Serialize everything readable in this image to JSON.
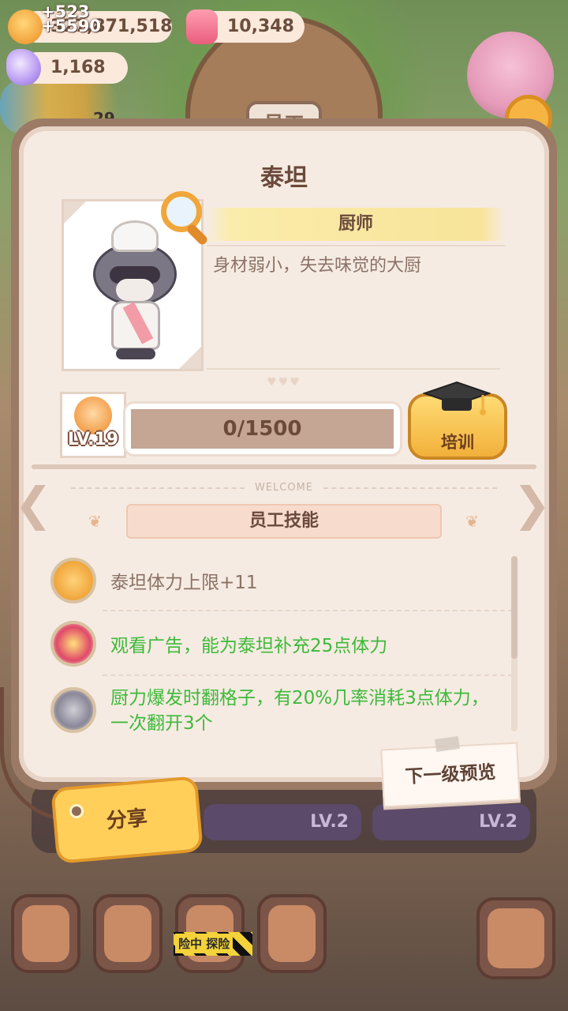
{
  "resources": {
    "gain_a": "+523",
    "gain_b": "+5590",
    "coins": "377,871,518",
    "gems": "10,348",
    "crystals": "1,168"
  },
  "background": {
    "title_tab": "员工",
    "lv_a": "LV.2",
    "lv_b": "LV.2",
    "adventure_badge": "险中 探险",
    "bubble_number": "29"
  },
  "employee": {
    "name": "泰坦",
    "role": "厨师",
    "description": "身材弱小，失去味觉的大厨",
    "level": "LV.19",
    "exp_text": "0/1500",
    "exp_current": 0,
    "exp_max": 1500
  },
  "buttons": {
    "train": "培训",
    "next_level_preview": "下一级预览",
    "share": "分享"
  },
  "skills": {
    "welcome": "WELCOME",
    "header": "员工技能",
    "items": [
      {
        "text": "泰坦体力上限+11",
        "color": "#8a7266",
        "icon": "muscle-character-icon"
      },
      {
        "text": "观看广告，能为泰坦补充25点体力",
        "color": "#3dba3a",
        "icon": "tv-ad-icon"
      },
      {
        "text": "厨力爆发时翻格子，有20%几率消耗3点体力，一次翻开3个",
        "color": "#3dba3a",
        "icon": "raccoon-burst-icon"
      }
    ]
  },
  "colors": {
    "accent": "#f2b03a",
    "panel": "#f6ebe2",
    "text_brown": "#6b4a3b",
    "skill_green": "#3dba3a"
  }
}
